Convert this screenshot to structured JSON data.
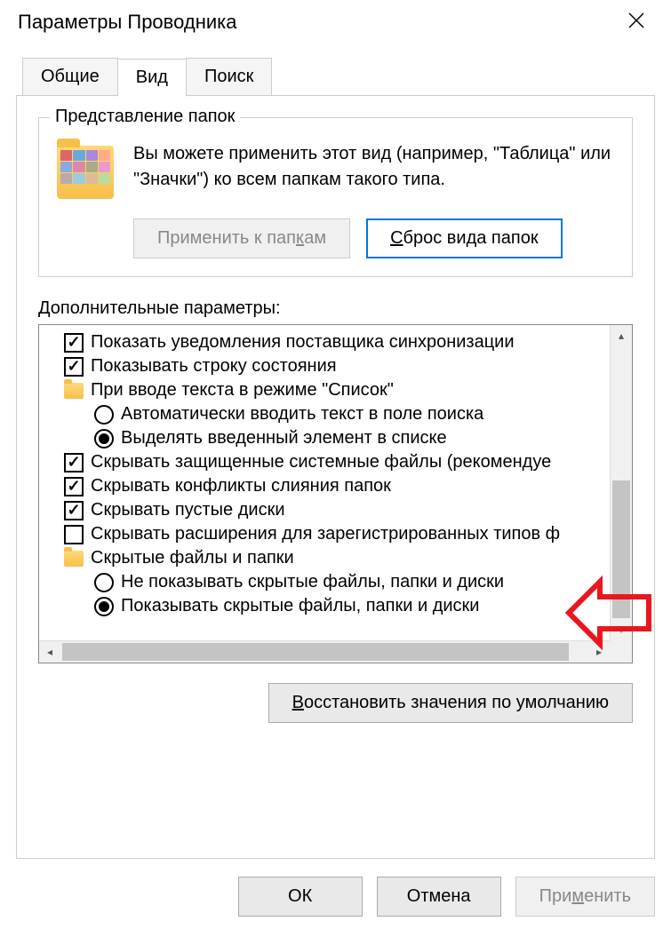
{
  "window": {
    "title": "Параметры Проводника",
    "close_icon": "close-icon"
  },
  "tabs": {
    "general": "Общие",
    "view": "Вид",
    "search": "Поиск"
  },
  "folderView": {
    "groupTitle": "Представление папок",
    "description": "Вы можете применить этот вид (например, \"Таблица\" или \"Значки\") ко всем папкам такого типа.",
    "applyBtn_pre": "Применить к пап",
    "applyBtn_ul": "к",
    "applyBtn_post": "ам",
    "resetBtn_ul": "С",
    "resetBtn_post": "брос вида папок"
  },
  "advanced": {
    "label": "Дополнительные параметры:",
    "items": [
      {
        "type": "checkbox",
        "checked": true,
        "label": "Показать уведомления поставщика синхронизации"
      },
      {
        "type": "checkbox",
        "checked": true,
        "label": "Показывать строку состояния"
      },
      {
        "type": "folder",
        "label": "При вводе текста в режиме \"Список\""
      },
      {
        "type": "radio",
        "checked": false,
        "label": "Автоматически вводить текст в поле поиска",
        "level": 2
      },
      {
        "type": "radio",
        "checked": true,
        "label": "Выделять введенный элемент в списке",
        "level": 2
      },
      {
        "type": "checkbox",
        "checked": true,
        "label": "Скрывать защищенные системные файлы (рекомендуе"
      },
      {
        "type": "checkbox",
        "checked": true,
        "label": "Скрывать конфликты слияния папок"
      },
      {
        "type": "checkbox",
        "checked": true,
        "label": "Скрывать пустые диски"
      },
      {
        "type": "checkbox",
        "checked": false,
        "label": "Скрывать расширения для зарегистрированных типов ф"
      },
      {
        "type": "folder",
        "label": "Скрытые файлы и папки"
      },
      {
        "type": "radio",
        "checked": false,
        "label": "Не показывать скрытые файлы, папки и диски",
        "level": 2
      },
      {
        "type": "radio",
        "checked": true,
        "label": "Показывать скрытые файлы, папки и диски",
        "level": 2
      }
    ]
  },
  "restoreBtn_ul": "В",
  "restoreBtn_post": "осстановить значения по умолчанию",
  "dialogButtons": {
    "ok": "ОК",
    "cancel": "Отмена",
    "apply_pre": "При",
    "apply_ul": "м",
    "apply_post": "енить"
  }
}
